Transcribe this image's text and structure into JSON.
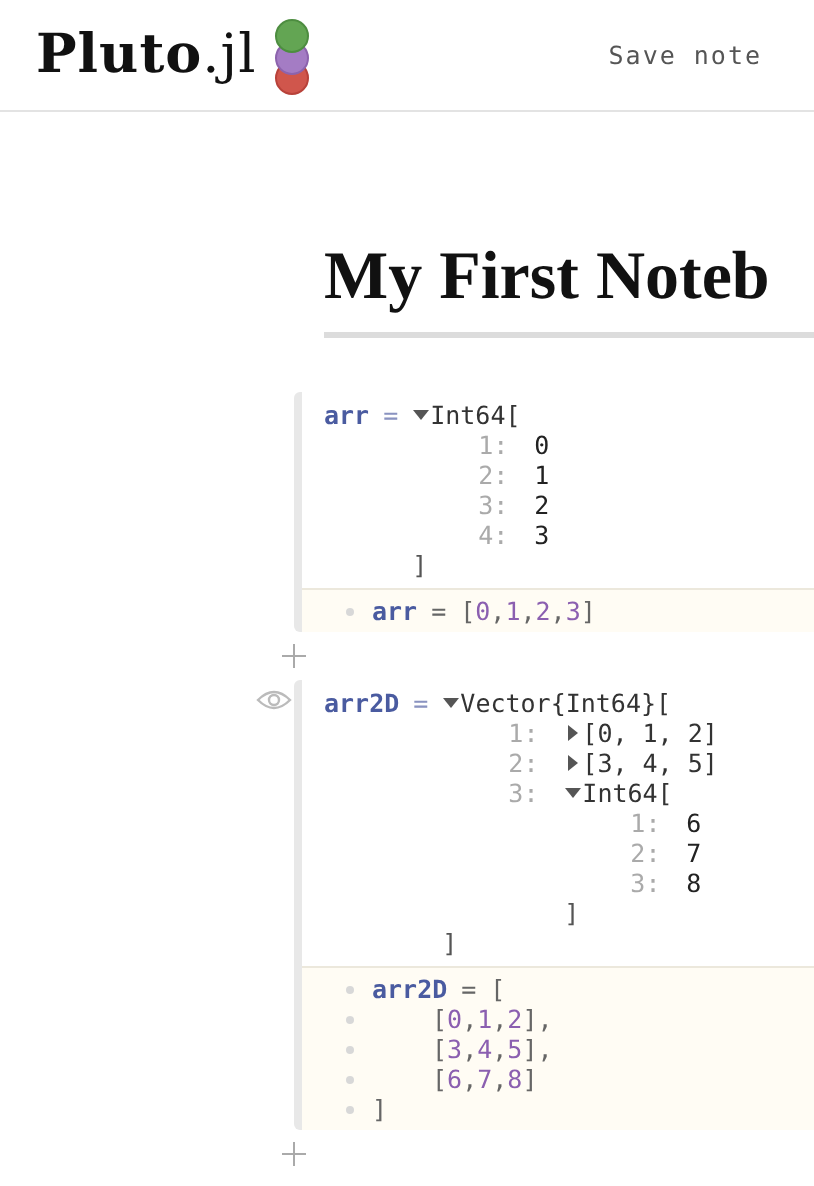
{
  "header": {
    "logo": "**Pluto**.jl",
    "save_label": "Save note"
  },
  "title": "My First Noteb",
  "cells": [
    {
      "show_eye": false,
      "output": {
        "name": "arr",
        "operator": "=",
        "value": {
          "kind": "array",
          "expanded": true,
          "label": "Int64[",
          "close": "]",
          "items": [
            {
              "index": "1:",
              "value": {
                "kind": "leaf",
                "text": "0"
              }
            },
            {
              "index": "2:",
              "value": {
                "kind": "leaf",
                "text": "1"
              }
            },
            {
              "index": "3:",
              "value": {
                "kind": "leaf",
                "text": "2"
              }
            },
            {
              "index": "4:",
              "value": {
                "kind": "leaf",
                "text": "3"
              }
            }
          ]
        }
      },
      "code": [
        {
          "indented": false,
          "tokens": [
            {
              "text": "arr",
              "kind": "name"
            },
            {
              "text": "=",
              "kind": "op"
            },
            {
              "text": "[",
              "kind": "punct"
            },
            {
              "text": "0",
              "kind": "number"
            },
            {
              "text": ",",
              "kind": "punct"
            },
            {
              "text": "1",
              "kind": "number"
            },
            {
              "text": ",",
              "kind": "punct"
            },
            {
              "text": "2",
              "kind": "number"
            },
            {
              "text": ",",
              "kind": "punct"
            },
            {
              "text": "3",
              "kind": "number"
            },
            {
              "text": "]",
              "kind": "punct"
            }
          ]
        }
      ]
    },
    {
      "show_eye": true,
      "output": {
        "name": "arr2D",
        "operator": "=",
        "value": {
          "kind": "array",
          "expanded": true,
          "label": "Vector{Int64}[",
          "close": "]",
          "items": [
            {
              "index": "1:",
              "value": {
                "kind": "array",
                "expanded": false,
                "label": "[0, 1, 2]"
              }
            },
            {
              "index": "2:",
              "value": {
                "kind": "array",
                "expanded": false,
                "label": "[3, 4, 5]"
              }
            },
            {
              "index": "3:",
              "value": {
                "kind": "array",
                "expanded": true,
                "label": "Int64[",
                "close": "]",
                "items": [
                  {
                    "index": "1:",
                    "value": {
                      "kind": "leaf",
                      "text": "6"
                    }
                  },
                  {
                    "index": "2:",
                    "value": {
                      "kind": "leaf",
                      "text": "7"
                    }
                  },
                  {
                    "index": "3:",
                    "value": {
                      "kind": "leaf",
                      "text": "8"
                    }
                  }
                ]
              }
            }
          ]
        }
      },
      "code": [
        {
          "indented": false,
          "tokens": [
            {
              "text": "arr2D",
              "kind": "name"
            },
            {
              "text": "=",
              "kind": "op"
            },
            {
              "text": "[",
              "kind": "punct"
            }
          ]
        },
        {
          "indented": true,
          "tokens": [
            {
              "text": "[",
              "kind": "punct"
            },
            {
              "text": "0",
              "kind": "number"
            },
            {
              "text": ",",
              "kind": "punct"
            },
            {
              "text": "1",
              "kind": "number"
            },
            {
              "text": ",",
              "kind": "punct"
            },
            {
              "text": "2",
              "kind": "number"
            },
            {
              "text": "],",
              "kind": "punct"
            }
          ]
        },
        {
          "indented": true,
          "tokens": [
            {
              "text": "[",
              "kind": "punct"
            },
            {
              "text": "3",
              "kind": "number"
            },
            {
              "text": ",",
              "kind": "punct"
            },
            {
              "text": "4",
              "kind": "number"
            },
            {
              "text": ",",
              "kind": "punct"
            },
            {
              "text": "5",
              "kind": "number"
            },
            {
              "text": "],",
              "kind": "punct"
            }
          ]
        },
        {
          "indented": true,
          "tokens": [
            {
              "text": "[",
              "kind": "punct"
            },
            {
              "text": "6",
              "kind": "number"
            },
            {
              "text": ",",
              "kind": "punct"
            },
            {
              "text": "7",
              "kind": "number"
            },
            {
              "text": ",",
              "kind": "punct"
            },
            {
              "text": "8",
              "kind": "number"
            },
            {
              "text": "]",
              "kind": "punct"
            }
          ]
        },
        {
          "indented": false,
          "tokens": [
            {
              "text": "]",
              "kind": "punct"
            }
          ]
        }
      ]
    }
  ]
}
